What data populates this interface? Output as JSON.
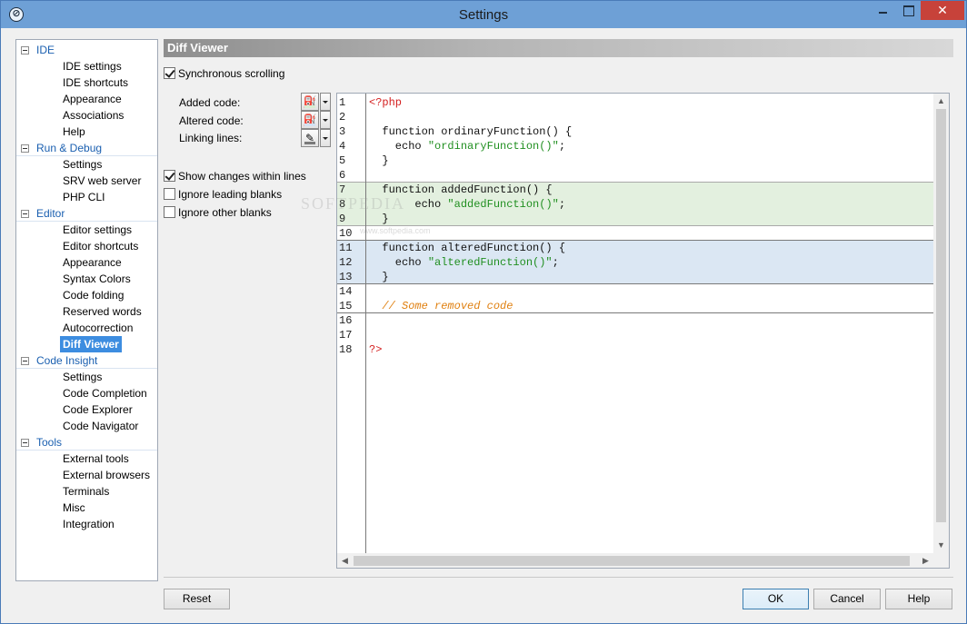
{
  "window": {
    "title": "Settings",
    "close_glyph": "✕"
  },
  "tree": {
    "categories": [
      {
        "label": "IDE",
        "children": [
          "IDE settings",
          "IDE shortcuts",
          "Appearance",
          "Associations",
          "Help"
        ]
      },
      {
        "label": "Run & Debug",
        "children": [
          "Settings",
          "SRV web server",
          "PHP CLI"
        ]
      },
      {
        "label": "Editor",
        "children": [
          "Editor settings",
          "Editor shortcuts",
          "Appearance",
          "Syntax Colors",
          "Code folding",
          "Reserved words",
          "Autocorrection",
          "Diff Viewer"
        ]
      },
      {
        "label": "Code Insight",
        "children": [
          "Settings",
          "Code Completion",
          "Code Explorer",
          "Code Navigator"
        ]
      },
      {
        "label": "Tools",
        "children": [
          "External tools",
          "External browsers",
          "Terminals",
          "Misc",
          "Integration"
        ]
      }
    ],
    "selected": "Diff Viewer"
  },
  "content": {
    "header": "Diff Viewer",
    "sync_scrolling": {
      "label": "Synchronous scrolling",
      "checked": true
    },
    "pickers": [
      {
        "label": "Added code:",
        "icon": "paint-bucket-icon",
        "color": "#d8ecd2"
      },
      {
        "label": "Altered code:",
        "icon": "paint-bucket-icon",
        "color": "#d4e2f2"
      },
      {
        "label": "Linking lines:",
        "icon": "pen-icon",
        "color": "#7a7a7a"
      }
    ],
    "show_changes": {
      "label": "Show changes within lines",
      "checked": true
    },
    "ignore_leading": {
      "label": "Ignore leading blanks",
      "checked": false
    },
    "ignore_other": {
      "label": "Ignore other blanks",
      "checked": false
    }
  },
  "preview": {
    "lines": [
      {
        "n": "1",
        "segments": [
          {
            "t": "<?php",
            "c": "red"
          }
        ]
      },
      {
        "n": "2",
        "segments": []
      },
      {
        "n": "3",
        "segments": [
          {
            "t": "  function ordinaryFunction() {",
            "c": "black"
          }
        ]
      },
      {
        "n": "4",
        "segments": [
          {
            "t": "    echo ",
            "c": "black"
          },
          {
            "t": "\"ordinaryFunction()\"",
            "c": "green"
          },
          {
            "t": ";",
            "c": "black"
          }
        ]
      },
      {
        "n": "5",
        "segments": [
          {
            "t": "  }",
            "c": "black"
          }
        ]
      },
      {
        "n": "6",
        "segments": []
      },
      {
        "n": "7",
        "segments": [
          {
            "t": "  function addedFunction() {",
            "c": "black"
          }
        ]
      },
      {
        "n": "8",
        "segments": [
          {
            "t": "       echo ",
            "c": "black"
          },
          {
            "t": "\"addedFunction()\"",
            "c": "green"
          },
          {
            "t": ";",
            "c": "black"
          }
        ]
      },
      {
        "n": "9",
        "segments": [
          {
            "t": "  }",
            "c": "black"
          }
        ]
      },
      {
        "n": "10",
        "segments": []
      },
      {
        "n": "11",
        "segments": [
          {
            "t": "  function alteredFunction() {",
            "c": "black"
          }
        ]
      },
      {
        "n": "12",
        "segments": [
          {
            "t": "    echo ",
            "c": "black"
          },
          {
            "t": "\"alteredFunction()\"",
            "c": "green"
          },
          {
            "t": ";",
            "c": "black"
          }
        ]
      },
      {
        "n": "13",
        "segments": [
          {
            "t": "  }",
            "c": "black"
          }
        ]
      },
      {
        "n": "14",
        "segments": []
      },
      {
        "n": "15",
        "segments": [
          {
            "t": "  // Some removed code",
            "c": "orange"
          }
        ]
      },
      {
        "n": "16",
        "segments": []
      },
      {
        "n": "17",
        "segments": []
      },
      {
        "n": "18",
        "segments": [
          {
            "t": "?>",
            "c": "red"
          }
        ]
      }
    ],
    "watermark": "SOFTPEDIA",
    "watermark_sub": "www.softpedia.com"
  },
  "buttons": {
    "reset": "Reset",
    "ok": "OK",
    "cancel": "Cancel",
    "help": "Help"
  }
}
